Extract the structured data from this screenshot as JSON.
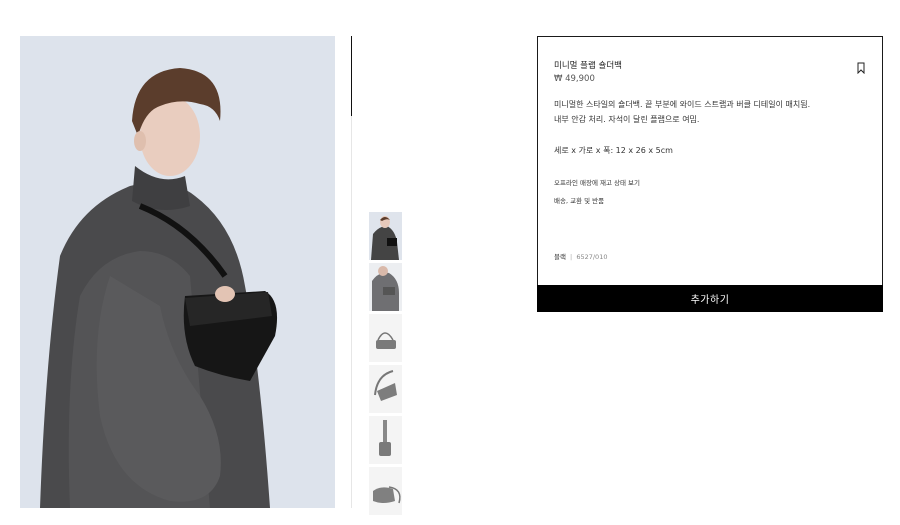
{
  "product": {
    "title": "미니멀 플랩 숄더백",
    "price": "₩ 49,900",
    "description_line1": "미니멀한 스타일의 숄더백. 끝 부분에 와이드 스트랩과 버클 디테일이 매치됨.",
    "description_line2": "내부 안감 처리. 자석이 달린 플랩으로 여밈.",
    "dimensions": "세로 x 가로 x 폭: 12 x 26 x 5cm",
    "store_stock_link": "오프라인 매장에 재고 상태 보기",
    "shipping_link": "배송, 교환 및 반품",
    "color_name": "블랙",
    "color_separator": "|",
    "reference": "6527/010",
    "add_button": "추가하기"
  },
  "icons": {
    "bookmark": "bookmark-icon"
  },
  "colors": {
    "button_bg": "#000000",
    "button_text": "#ffffff",
    "border": "#1a1a1a"
  }
}
